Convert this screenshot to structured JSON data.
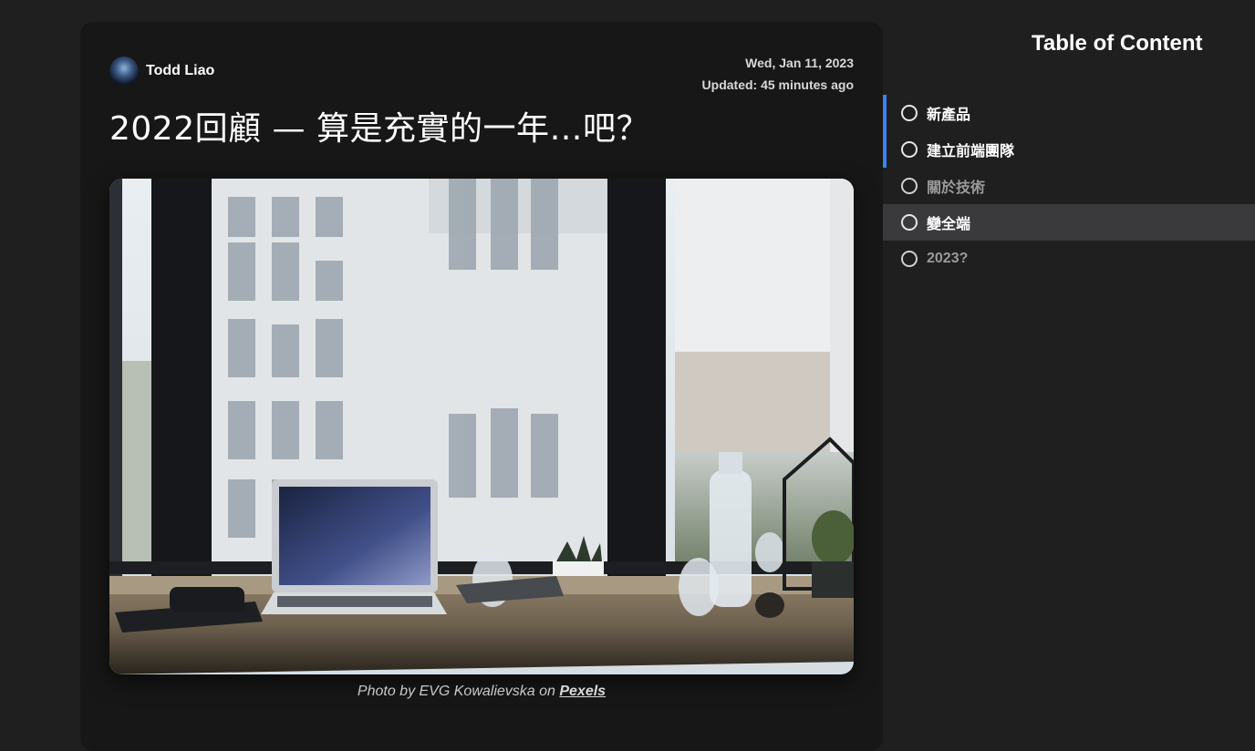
{
  "article": {
    "author": "Todd Liao",
    "date": "Wed, Jan 11, 2023",
    "updated": "Updated: 45 minutes ago",
    "title": "2022回顧 — 算是充實的一年…吧？",
    "caption_prefix": "Photo by EVG Kowalievska on ",
    "caption_link": "Pexels"
  },
  "toc": {
    "title": "Table of Content",
    "items": [
      {
        "label": "新產品",
        "state": "active"
      },
      {
        "label": "建立前端團隊",
        "state": "active"
      },
      {
        "label": "關於技術",
        "state": "dim"
      },
      {
        "label": "變全端",
        "state": "hover"
      },
      {
        "label": "2023?",
        "state": "dim"
      }
    ]
  },
  "colors": {
    "page_bg": "#1f1f1f",
    "card_bg": "#171717",
    "accent": "#3b82f6",
    "hover_bg": "#3a3a3c"
  }
}
